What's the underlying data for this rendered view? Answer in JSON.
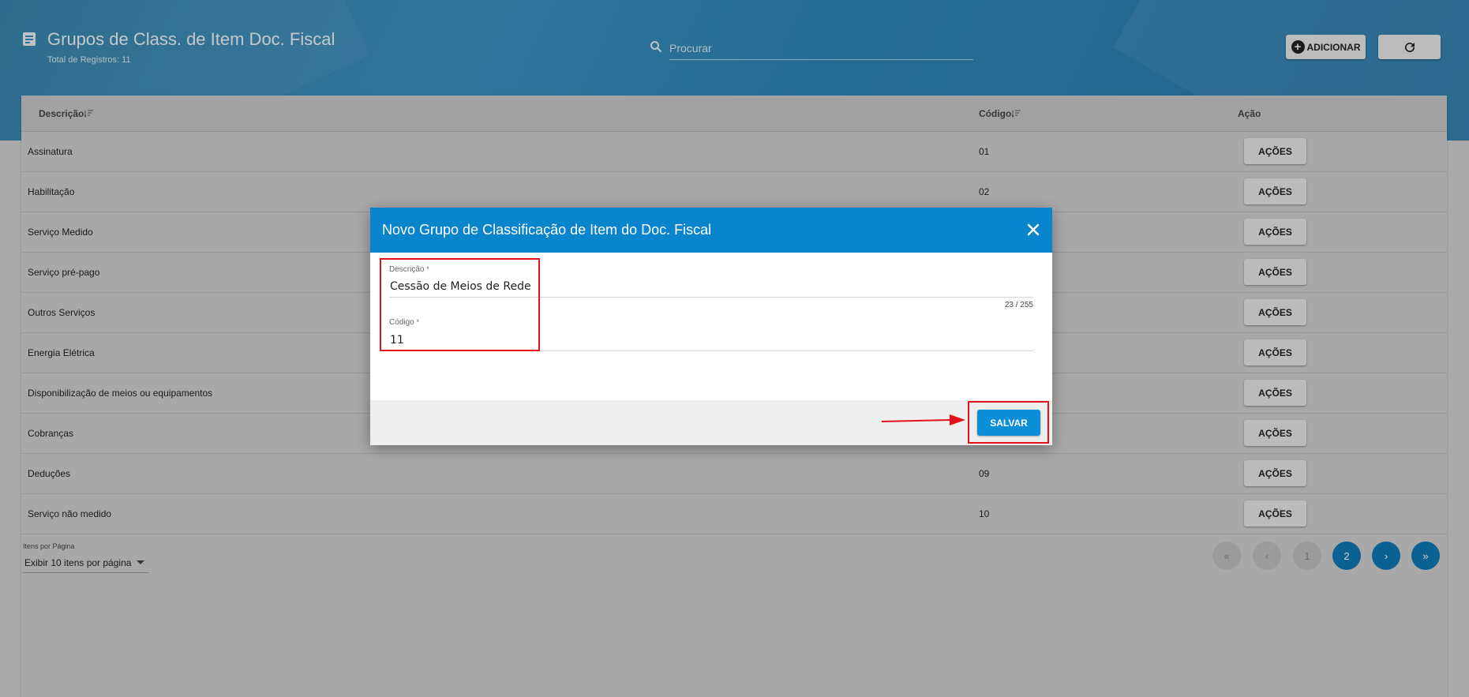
{
  "header": {
    "title": "Grupos de Class. de Item Doc. Fiscal",
    "subtitle": "Total de Registros: 11",
    "search_placeholder": "Procurar",
    "add_label": "ADICIONAR",
    "icons": {
      "page": "list-document-icon",
      "search": "search-icon",
      "refresh": "refresh-icon",
      "add": "add-circle-icon"
    }
  },
  "table": {
    "columns": [
      "Descrição",
      "Código",
      "Ação"
    ],
    "rows": [
      {
        "descricao": "Assinatura",
        "codigo": "01",
        "acao": "AÇÕES"
      },
      {
        "descricao": "Habilitação",
        "codigo": "02",
        "acao": "AÇÕES"
      },
      {
        "descricao": "Serviço Medido",
        "codigo": "",
        "acao": "AÇÕES"
      },
      {
        "descricao": "Serviço pré-pago",
        "codigo": "",
        "acao": "AÇÕES"
      },
      {
        "descricao": "Outros Serviços",
        "codigo": "",
        "acao": "AÇÕES"
      },
      {
        "descricao": "Energia Elétrica",
        "codigo": "",
        "acao": "AÇÕES"
      },
      {
        "descricao": "Disponibilização de meios ou equipamentos",
        "codigo": "",
        "acao": "AÇÕES"
      },
      {
        "descricao": "Cobranças",
        "codigo": "",
        "acao": "AÇÕES"
      },
      {
        "descricao": "Deduções",
        "codigo": "09",
        "acao": "AÇÕES"
      },
      {
        "descricao": "Serviço não medido",
        "codigo": "10",
        "acao": "AÇÕES"
      }
    ]
  },
  "pagination": {
    "per_page_label": "Itens por Página",
    "per_page_value": "Exibir 10 itens por página",
    "first": "«",
    "prev": "‹",
    "pages": [
      "1",
      "2"
    ],
    "current_page": "2",
    "next": "›",
    "last": "»"
  },
  "modal": {
    "title": "Novo Grupo de Classificação de Item do Doc. Fiscal",
    "fields": {
      "descricao_label": "Descrição",
      "descricao_value": "Cessão de Meios de Rede",
      "descricao_counter": "23 / 255",
      "codigo_label": "Código",
      "codigo_value": "11",
      "required_mark": "*"
    },
    "save_label": "SALVAR"
  },
  "colors": {
    "header_blue": "#2f86b6",
    "modal_header": "#0a84cc",
    "primary_button": "#0b8fd9",
    "annotation_red": "#e3121a",
    "active_page": "#0b78b3"
  }
}
